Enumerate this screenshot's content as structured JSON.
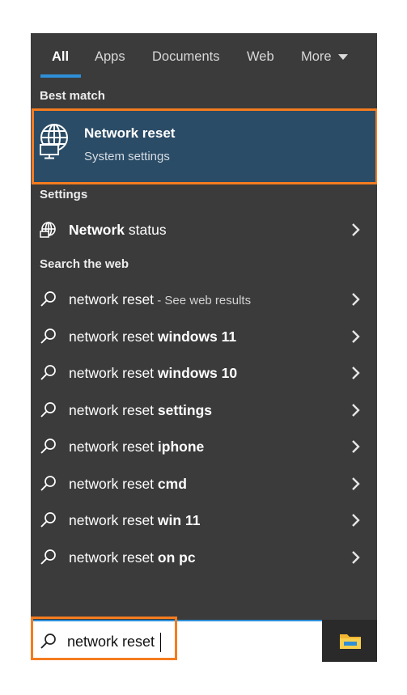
{
  "tabs": [
    {
      "label": "All"
    },
    {
      "label": "Apps"
    },
    {
      "label": "Documents"
    },
    {
      "label": "Web"
    },
    {
      "label": "More"
    }
  ],
  "best_match": {
    "heading": "Best match",
    "title": "Network reset",
    "subtitle": "System settings",
    "icon": "globe-monitor-icon"
  },
  "settings": {
    "heading": "Settings",
    "items": [
      {
        "bold": "Network",
        "rest": " status",
        "icon": "globe-icon"
      }
    ]
  },
  "web": {
    "heading": "Search the web",
    "items": [
      {
        "query": "network reset",
        "suffix": "",
        "hint": " - See web results"
      },
      {
        "query": "network reset ",
        "suffix": "windows 11"
      },
      {
        "query": "network reset ",
        "suffix": "windows 10"
      },
      {
        "query": "network reset ",
        "suffix": "settings"
      },
      {
        "query": "network reset ",
        "suffix": "iphone"
      },
      {
        "query": "network reset ",
        "suffix": "cmd"
      },
      {
        "query": "network reset ",
        "suffix": "win 11"
      },
      {
        "query": "network reset ",
        "suffix": "on pc"
      }
    ]
  },
  "search": {
    "value": "network reset",
    "icon": "search-icon"
  },
  "taskbar": {
    "icon": "file-explorer-icon"
  },
  "colors": {
    "panel": "#3b3b3b",
    "selected": "#2b4c66",
    "accent": "#2f8fd8",
    "highlight_outline": "#f57c1f"
  }
}
